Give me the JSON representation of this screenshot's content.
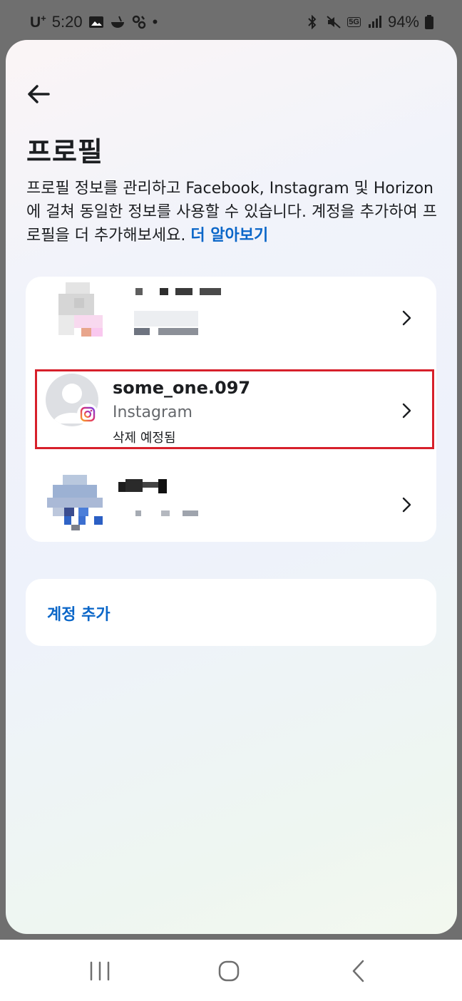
{
  "status_bar": {
    "carrier": "U",
    "carrier_sup": "+",
    "time": "5:20",
    "dot": "•",
    "network": "5G",
    "battery": "94%"
  },
  "header": {
    "title": "프로필",
    "description": "프로필 정보를 관리하고 Facebook, Instagram 및 Horizon에 걸쳐 동일한 정보를 사용할 수 있습니다. 계정을 추가하여 프로필을 더 추가해보세요.",
    "learn_more": "더 알아보기"
  },
  "accounts": [
    {
      "name": "some_one.097",
      "platform": "Instagram",
      "status": "삭제 예정됨"
    }
  ],
  "add_account": {
    "label": "계정 추가"
  },
  "colors": {
    "link": "#0a66c8",
    "highlight": "#d7202b"
  },
  "icons": [
    "back-arrow-icon",
    "chevron-right-icon",
    "instagram-icon",
    "recents-icon",
    "home-icon",
    "back-icon"
  ]
}
